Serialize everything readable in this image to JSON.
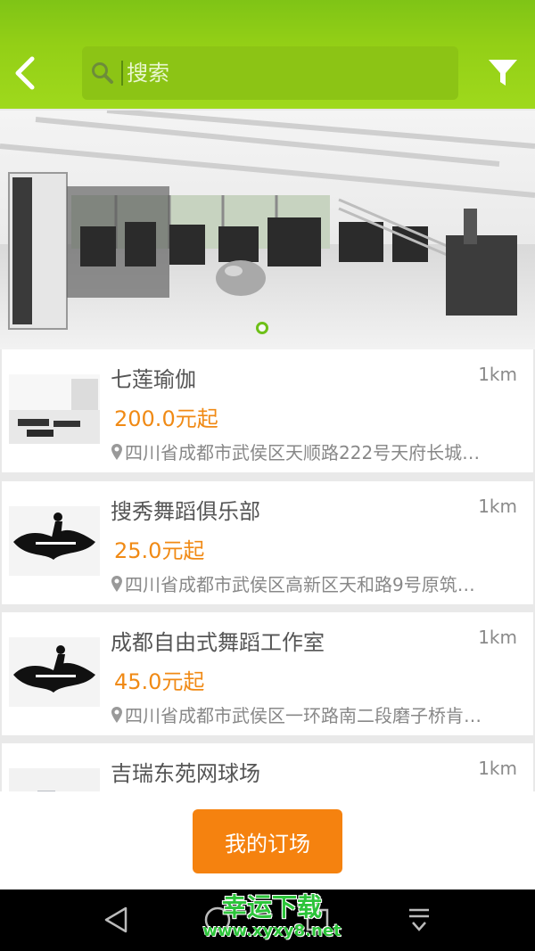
{
  "header": {
    "search_placeholder": "搜索",
    "accent_color": "#93cf16"
  },
  "banner": {
    "page_indicator_active": 1,
    "page_count": 1
  },
  "venues": [
    {
      "name": "七莲瑜伽",
      "distance": "1km",
      "price": "200.0元起",
      "address": "四川省成都市武侯区天顺路222号天府长城…"
    },
    {
      "name": "搜秀舞蹈俱乐部",
      "distance": "1km",
      "price": "25.0元起",
      "address": "四川省成都市武侯区高新区天和路9号原筑…"
    },
    {
      "name": "成都自由式舞蹈工作室",
      "distance": "1km",
      "price": "45.0元起",
      "address": "四川省成都市武侯区一环路南二段磨子桥肯…"
    },
    {
      "name": "吉瑞东苑网球场",
      "distance": "1km",
      "price": "",
      "address": ""
    }
  ],
  "bottom": {
    "my_booking_label": "我的订场",
    "button_color": "#f5820f"
  },
  "navbar": {
    "icons": [
      "back-triangle-icon",
      "home-circle-icon",
      "recents-square-icon",
      "notification-pull-icon"
    ]
  },
  "watermark": {
    "title": "幸运下载",
    "url": "www.xyxy8.net"
  }
}
